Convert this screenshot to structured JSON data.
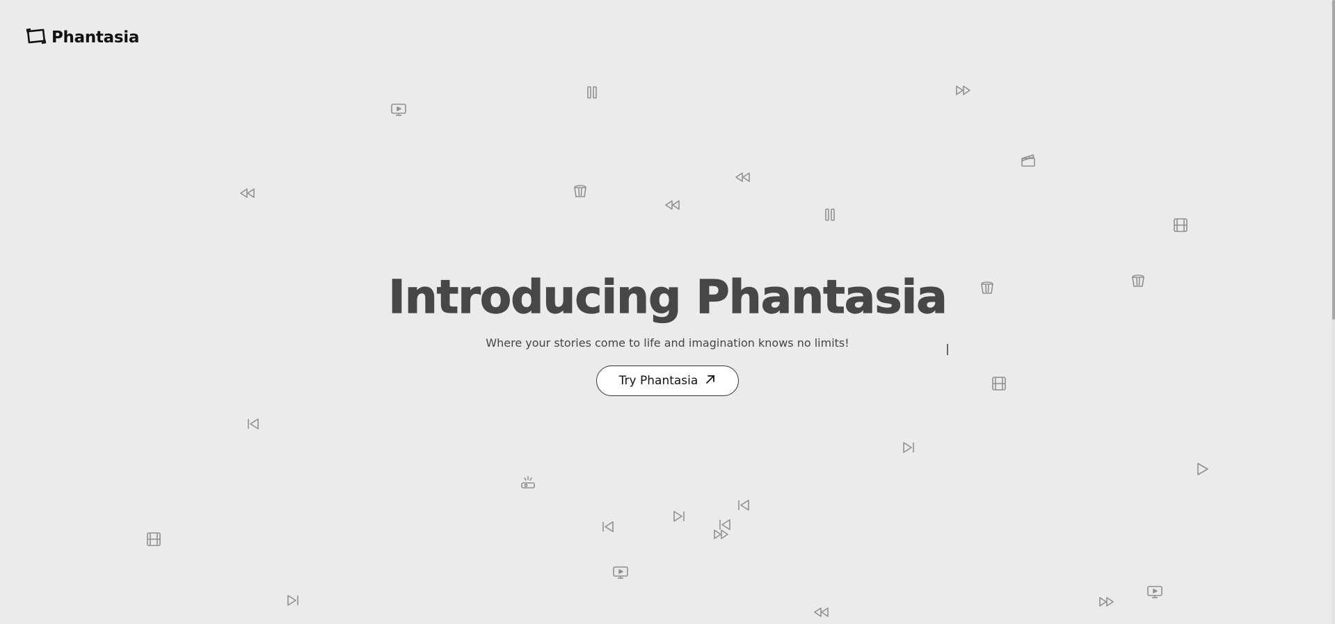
{
  "header": {
    "logo_icon": "film-frame-icon",
    "brand_name": "Phantasia"
  },
  "hero": {
    "title": "Introducing Phantasia",
    "subtitle": "Where your stories come to life and imagination knows no limits!",
    "cta_label": "Try Phantasia",
    "cta_icon": "arrow-up-right-icon"
  },
  "colors": {
    "background": "#ebebeb",
    "title": "#474747",
    "icon": "#8f8f8f",
    "button_bg": "#ffffff",
    "button_border": "#333333"
  },
  "background_icon_types": [
    "pause-icon",
    "fast-forward-icon",
    "rewind-icon",
    "skip-back-icon",
    "skip-forward-icon",
    "play-icon",
    "monitor-play-icon",
    "popcorn-icon",
    "film-strip-icon",
    "clapperboard-icon",
    "projector-icon"
  ]
}
